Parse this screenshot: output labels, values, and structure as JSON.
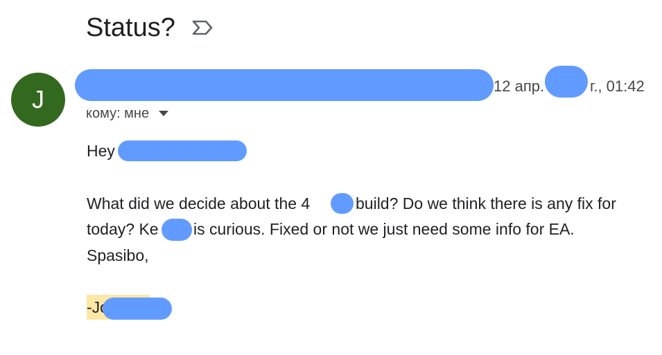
{
  "subject": "Status?",
  "avatar": {
    "letter": "J",
    "color": "#33691e"
  },
  "date": {
    "part1": "12 апр.",
    "part2": "г., 01:42"
  },
  "recipient": {
    "label": "кому: мне"
  },
  "body": {
    "greeting": "Hey",
    "line1a": "What did we decide about the 4",
    "line1b": "build? Do we think there is any fix for",
    "line2a": "today? Ke",
    "line2b": "is curious. Fixed or not we just need some info for EA.",
    "line3": "Spasibo,",
    "signature": "-Jo"
  },
  "colors": {
    "redaction": "#619bff",
    "highlight": "#fce8a6",
    "text": "#202124"
  }
}
